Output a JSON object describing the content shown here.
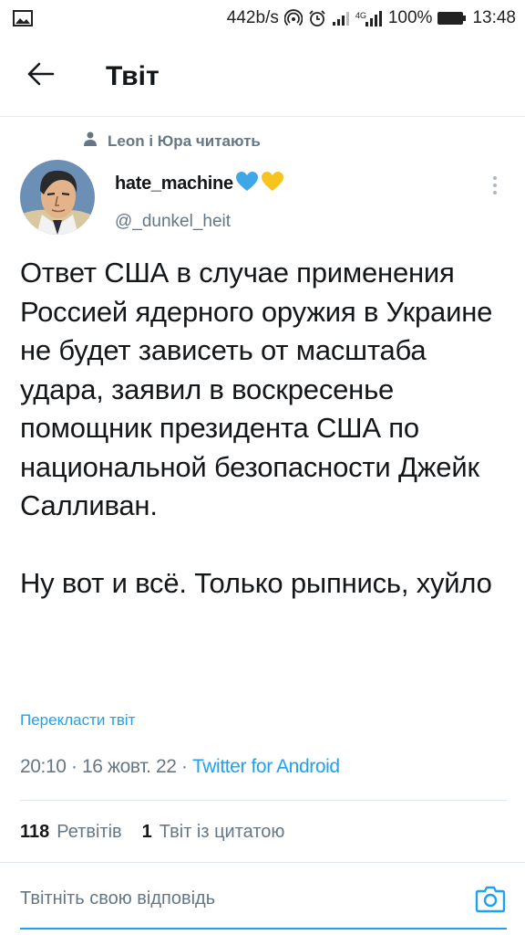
{
  "status_bar": {
    "speed": "442b/s",
    "network": "4G",
    "battery": "100%",
    "time": "13:48",
    "icons": [
      "image-icon",
      "hotspot-icon",
      "alarm-icon",
      "signal-icon",
      "signal-4g-icon",
      "battery-icon"
    ]
  },
  "header": {
    "title": "Твіт",
    "back_icon": "arrow-left-icon"
  },
  "social_context": {
    "text": "Leon і Юра читають",
    "icon": "person-icon"
  },
  "tweet": {
    "author_name": "hate_machine",
    "author_emojis": [
      "blue-heart-icon",
      "yellow-heart-icon"
    ],
    "handle": "@_dunkel_heit",
    "text": "Ответ США в случае применения Россией ядерного оружия в Украине не будет зависеть от масштаба удара, заявил в воскресенье помощник президента США по национальной безопасности Джейк Салливан.\n\nНу вот и всё. Только рыпнись, хуйло",
    "translate_label": "Перекласти твіт",
    "timestamp": "20:10 · 16 жовт. 22 · ",
    "source": "Twitter for Android"
  },
  "stats": {
    "retweets_count": "118",
    "retweets_label": "Ретвітів",
    "quotes_count": "1",
    "quotes_label": "Твіт із цитатою"
  },
  "reply": {
    "placeholder": "Твітніть свою відповідь",
    "camera_icon": "camera-icon"
  },
  "colors": {
    "accent": "#1da1f2",
    "secondary_text": "#657786",
    "primary_text": "#14171a",
    "divider": "#e1e8ed"
  }
}
